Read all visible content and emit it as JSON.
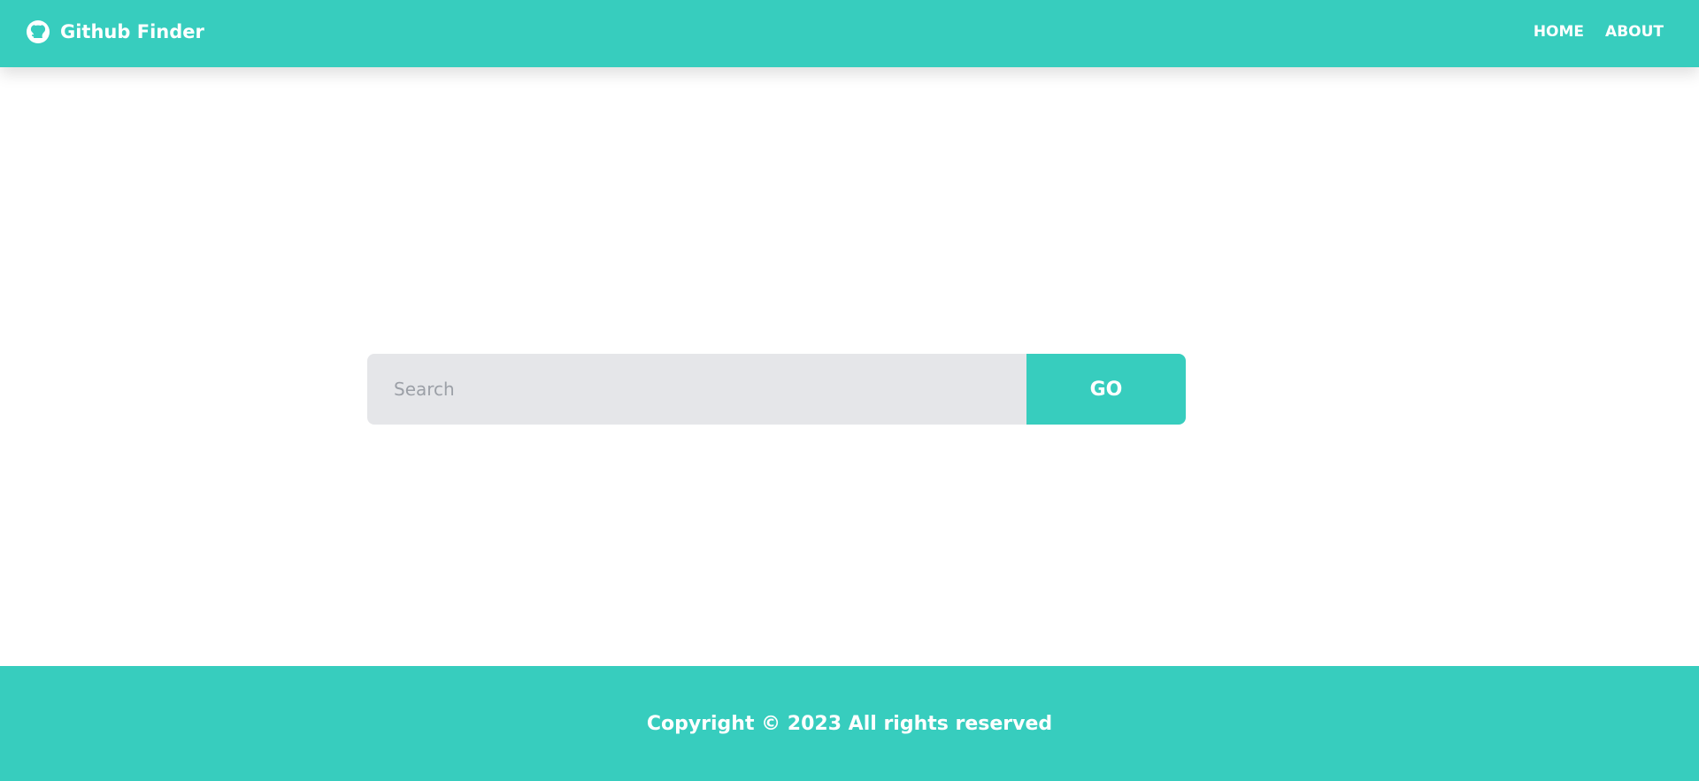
{
  "app": {
    "brand_title": "Github Finder",
    "brand_icon": "github-icon"
  },
  "nav": {
    "items": [
      {
        "label": "HOME"
      },
      {
        "label": "ABOUT"
      }
    ]
  },
  "search": {
    "placeholder": "Search",
    "value": "",
    "button_label": "GO"
  },
  "footer": {
    "copyright": "Copyright © 2023 All rights reserved"
  },
  "colors": {
    "accent": "#37cdbe",
    "input_background": "#e5e6e9",
    "text_on_accent": "#ffffff"
  }
}
